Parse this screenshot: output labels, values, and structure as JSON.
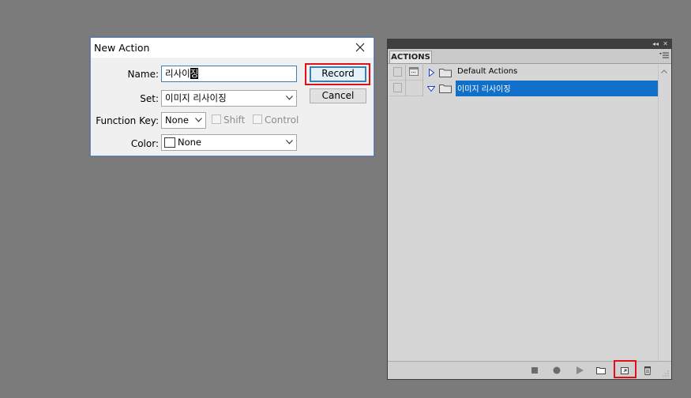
{
  "dialog": {
    "title": "New Action",
    "name_label": "Name:",
    "name_value_plain": "리사이",
    "name_value_selected": "징",
    "set_label": "Set:",
    "set_value": "이미지 리사이징",
    "function_key_label": "Function Key:",
    "function_key_value": "None",
    "shift_label": "Shift",
    "control_label": "Control",
    "color_label": "Color:",
    "color_value": "None",
    "record_button": "Record",
    "cancel_button": "Cancel"
  },
  "panel": {
    "tab_label": "ACTIONS",
    "rows": [
      {
        "name": "Default Actions",
        "expanded": false,
        "selected": false
      },
      {
        "name": "이미지 리사이징",
        "expanded": true,
        "selected": true
      }
    ]
  },
  "colors": {
    "desktop": "#7b7b7b",
    "highlight": "#e0101a",
    "selection": "#0f6fc9"
  }
}
